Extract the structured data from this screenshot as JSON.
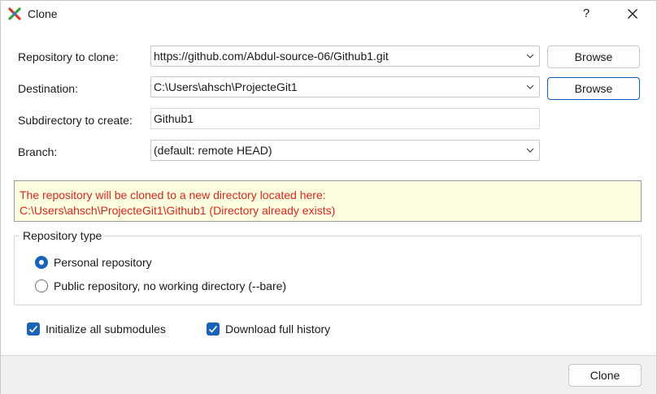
{
  "window": {
    "title": "Clone",
    "help_label": "?"
  },
  "form": {
    "repository_label": "Repository to clone:",
    "repository_value": "https://github.com/Abdul-source-06/Github1.git",
    "destination_label": "Destination:",
    "destination_value": "C:\\Users\\ahsch\\ProjecteGit1",
    "subdirectory_label": "Subdirectory to create:",
    "subdirectory_value": "Github1",
    "branch_label": "Branch:",
    "branch_value": "(default: remote HEAD)",
    "browse_label": "Browse"
  },
  "info": {
    "line1": "The repository will be cloned to a new directory located here:",
    "line2": "C:\\Users\\ahsch\\ProjecteGit1\\Github1 (Directory already exists)",
    "color": "#d8281d"
  },
  "repo_type": {
    "title": "Repository type",
    "options": [
      {
        "label": "Personal repository",
        "selected": true
      },
      {
        "label": "Public repository, no working directory  (--bare)",
        "selected": false
      }
    ]
  },
  "checkboxes": [
    {
      "label": "Initialize all submodules",
      "checked": true
    },
    {
      "label": "Download full history",
      "checked": true
    }
  ],
  "footer": {
    "clone_label": "Clone"
  },
  "colors": {
    "accent": "#1a63b8",
    "focus_border": "#0a5db8",
    "info_bg": "#fdfde0"
  }
}
